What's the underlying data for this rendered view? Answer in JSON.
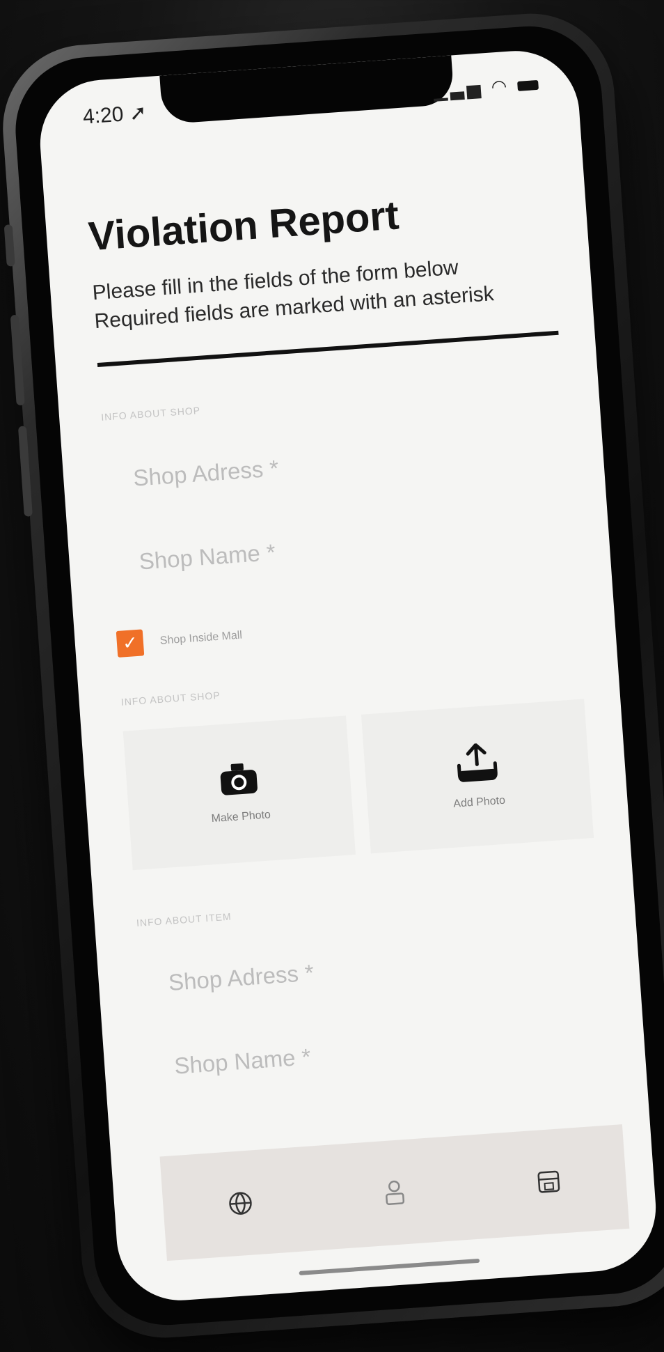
{
  "status": {
    "time": "4:20",
    "location_icon": "location-arrow-icon",
    "signal_icon": "signal-icon",
    "wifi_icon": "wifi-icon",
    "battery_icon": "battery-icon"
  },
  "form": {
    "title": "Violation Report",
    "subtitle": "Please fill in the fields of the form below Required fields are marked with an asterisk",
    "sections": [
      {
        "label": "INFO ABOUT SHOP",
        "fields": [
          "Shop Adress *",
          "Shop Name *"
        ]
      },
      {
        "label": "INFO ABOUT SHOP"
      },
      {
        "label": "INFO ABOUT ITEM",
        "fields": [
          "Shop Adress *",
          "Shop Name *"
        ]
      }
    ],
    "checkbox": {
      "label": "Shop Inside Mall",
      "checked": true,
      "color": "#f07028"
    },
    "photo": {
      "make_photo": {
        "label": "Make Photo",
        "icon": "camera-icon"
      },
      "add_photo": {
        "label": "Add Photo",
        "icon": "upload-icon"
      }
    }
  },
  "tabbar": {
    "items": [
      {
        "icon": "globe-icon"
      },
      {
        "icon": "user-icon"
      },
      {
        "icon": "shop-icon"
      }
    ]
  }
}
